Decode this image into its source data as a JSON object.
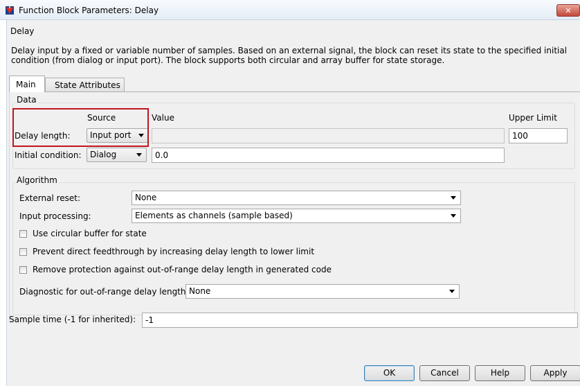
{
  "window": {
    "title": "Function Block Parameters: Delay",
    "close_label": "✕"
  },
  "block": {
    "name": "Delay",
    "description_line1": "Delay input by a fixed or variable number of samples. Based on an external signal, the block can reset its state to the specified initial",
    "description_line2": "condition (from dialog or input port). The block supports both circular and array buffer for state storage."
  },
  "tabs": [
    "Main",
    "State Attributes"
  ],
  "data_group": {
    "legend": "Data",
    "col_source": "Source",
    "col_value": "Value",
    "col_upper_limit": "Upper Limit",
    "delay_length_label": "Delay length:",
    "delay_length_source": "Input port",
    "delay_length_value": "",
    "upper_limit_value": "100",
    "initial_condition_label": "Initial condition:",
    "initial_condition_source": "Dialog",
    "initial_condition_value": "0.0"
  },
  "algorithm_group": {
    "legend": "Algorithm",
    "external_reset_label": "External reset:",
    "external_reset_value": "None",
    "input_processing_label": "Input processing:",
    "input_processing_value": "Elements as channels (sample based)",
    "cb_circular_buffer": "Use circular buffer for state",
    "cb_prevent_feedthrough": "Prevent direct feedthrough by increasing delay length to lower limit",
    "cb_remove_protection": "Remove protection against out-of-range delay length in generated code",
    "diagnostic_label": "Diagnostic for out-of-range delay length:",
    "diagnostic_value": "None"
  },
  "sample_time": {
    "label": "Sample time (-1 for inherited):",
    "value": "-1"
  },
  "buttons": {
    "ok": "OK",
    "cancel": "Cancel",
    "help": "Help",
    "apply": "Apply"
  },
  "colors": {
    "highlight_box": "#c0141c",
    "default_button_border": "#3c7fb1"
  },
  "icons": {
    "title_icon": "simulink-block-icon"
  }
}
